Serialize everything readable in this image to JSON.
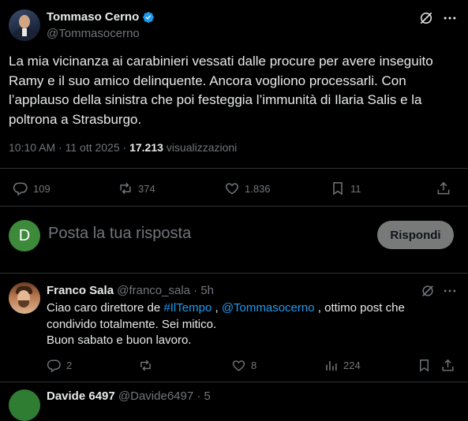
{
  "tweet": {
    "author_name": "Tommaso Cerno",
    "author_handle": "@Tommasocerno",
    "text": "La mia vicinanza ai carabinieri vessati dalle procure per avere inseguito Ramy e il suo amico delinquente. Ancora vogliono processarli. Con l’applauso della sinistra che poi festeggia l’immunità di Ilaria Salis e la poltrona a Strasburgo.",
    "time": "10:10 AM",
    "date": "11 ott 2025",
    "views_count": "17.213",
    "views_label": "visualizzazioni",
    "actions": {
      "replies": "109",
      "retweets": "374",
      "likes": "1.836",
      "bookmarks": "11"
    },
    "accent_color": "#1d9bf0"
  },
  "compose": {
    "avatar_letter": "D",
    "avatar_color": "#3d8a3a",
    "placeholder": "Posta la tua risposta",
    "button_label": "Rispondi"
  },
  "replies": [
    {
      "author_name": "Franco Sala",
      "author_handle": "@franco_sala",
      "time_ago": "5h",
      "text_before": "Ciao caro direttore de ",
      "hashtag": "#IlTempo",
      "text_middle": " , ",
      "mention": "@Tommasocerno",
      "text_after": " , ottimo post che condivido totalmente. Sei mitico.",
      "line2": "Buon sabato e buon lavoro.",
      "replies": "2",
      "retweets": "",
      "likes": "8",
      "views": "224"
    }
  ],
  "next_reply": {
    "author_name": "Davide 6497",
    "author_handle": "@Davide6497",
    "time_ago": "5"
  },
  "icons": [
    "verified-badge-icon",
    "grok-icon",
    "more-icon",
    "reply-icon",
    "retweet-icon",
    "like-icon",
    "bookmark-icon",
    "share-icon",
    "views-icon"
  ]
}
